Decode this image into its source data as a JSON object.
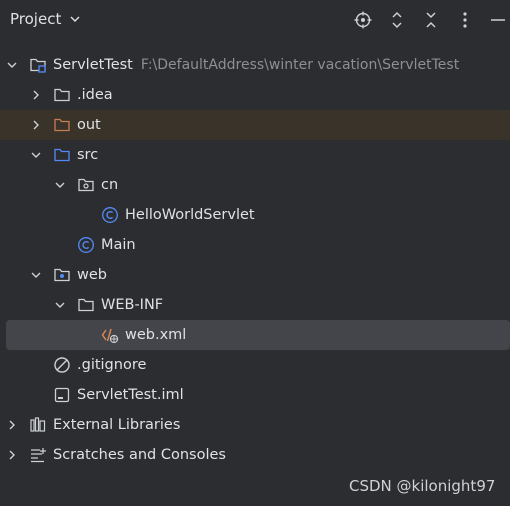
{
  "header": {
    "title": "Project",
    "icons": [
      "locate-icon",
      "expand-icon",
      "collapse-icon",
      "more-icon",
      "minimize-icon"
    ]
  },
  "tree": {
    "root": {
      "label": "ServletTest",
      "path": "F:\\DefaultAddress\\winter vacation\\ServletTest"
    },
    "idea": {
      "label": ".idea"
    },
    "out": {
      "label": "out"
    },
    "src": {
      "label": "src"
    },
    "cn": {
      "label": "cn"
    },
    "hello": {
      "label": "HelloWorldServlet"
    },
    "main": {
      "label": "Main"
    },
    "web": {
      "label": "web"
    },
    "webinf": {
      "label": "WEB-INF"
    },
    "webxml": {
      "label": "web.xml"
    },
    "gitignore": {
      "label": ".gitignore"
    },
    "iml": {
      "label": "ServletTest.iml"
    },
    "extlib": {
      "label": "External Libraries"
    },
    "scratches": {
      "label": "Scratches and Consoles"
    }
  },
  "colors": {
    "background": "#2b2d30",
    "excluded_row": "#3a3329",
    "selected_row": "#43454a",
    "folder_blue": "#548af7",
    "folder_orange": "#c77d55",
    "class_blue": "#548af7",
    "xml_orange": "#e08855"
  },
  "watermark": "CSDN @kilonight97"
}
